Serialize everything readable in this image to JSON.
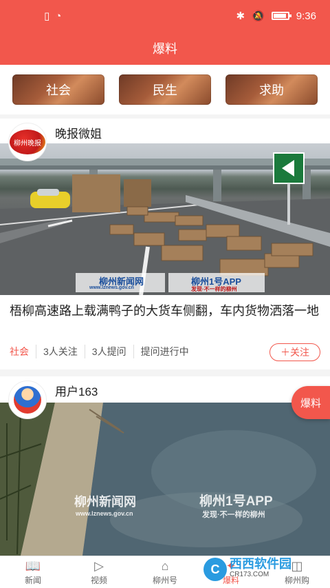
{
  "status_bar": {
    "time": "9:36"
  },
  "header": {
    "title": "爆料"
  },
  "categories": [
    {
      "label": "社会"
    },
    {
      "label": "民生"
    },
    {
      "label": "求助"
    }
  ],
  "posts": [
    {
      "author": "晚报微姐",
      "title": "梧柳高速路上载满鸭子的大货车侧翻，车内货物洒落一地",
      "meta": {
        "category": "社会",
        "follows": "3人关注",
        "questions": "3人提问",
        "status": "提问进行中"
      },
      "follow_label": "＋关注",
      "watermarks": [
        "柳州新闻网",
        "柳州1号APP",
        "www.lznews.gov.cn",
        "发现·不一样的柳州"
      ],
      "avatar_text": "柳州晚报"
    },
    {
      "author": "用户163",
      "watermarks": [
        "柳州新闻网",
        "柳州1号APP",
        "www.lznews.gov.cn",
        "发现·不一样的柳州"
      ]
    }
  ],
  "fab": {
    "label": "爆料"
  },
  "tabbar": [
    {
      "label": "新闻",
      "icon": "book-icon"
    },
    {
      "label": "视频",
      "icon": "play-icon"
    },
    {
      "label": "柳州号",
      "icon": "hat-icon"
    },
    {
      "label": "爆料",
      "icon": "fire-icon"
    },
    {
      "label": "柳州购",
      "icon": "bag-icon"
    }
  ],
  "watermark": {
    "main": "西西软件园",
    "sub": "CR173.COM",
    "badge": "C"
  }
}
